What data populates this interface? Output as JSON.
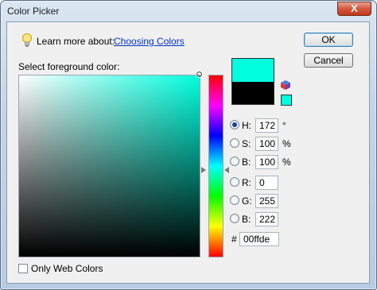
{
  "window": {
    "title": "Color Picker",
    "close_label": "X"
  },
  "learn": {
    "prefix": "Learn more about:",
    "link": "Choosing Colors"
  },
  "picker": {
    "label": "Select foreground color:"
  },
  "colors": {
    "new": "#00ffde",
    "old": "#000000"
  },
  "hsb": [
    {
      "label": "H:",
      "value": "172",
      "unit": "°",
      "checked": true
    },
    {
      "label": "S:",
      "value": "100",
      "unit": "%",
      "checked": false
    },
    {
      "label": "B:",
      "value": "100",
      "unit": "%",
      "checked": false
    }
  ],
  "rgb": [
    {
      "label": "R:",
      "value": "0",
      "checked": false
    },
    {
      "label": "G:",
      "value": "255",
      "checked": false
    },
    {
      "label": "B:",
      "value": "222",
      "checked": false
    }
  ],
  "hex": {
    "symbol": "#",
    "value": "00ffde"
  },
  "buttons": {
    "ok": "OK",
    "cancel": "Cancel"
  },
  "web_colors": {
    "label": "Only Web Colors",
    "checked": false
  }
}
